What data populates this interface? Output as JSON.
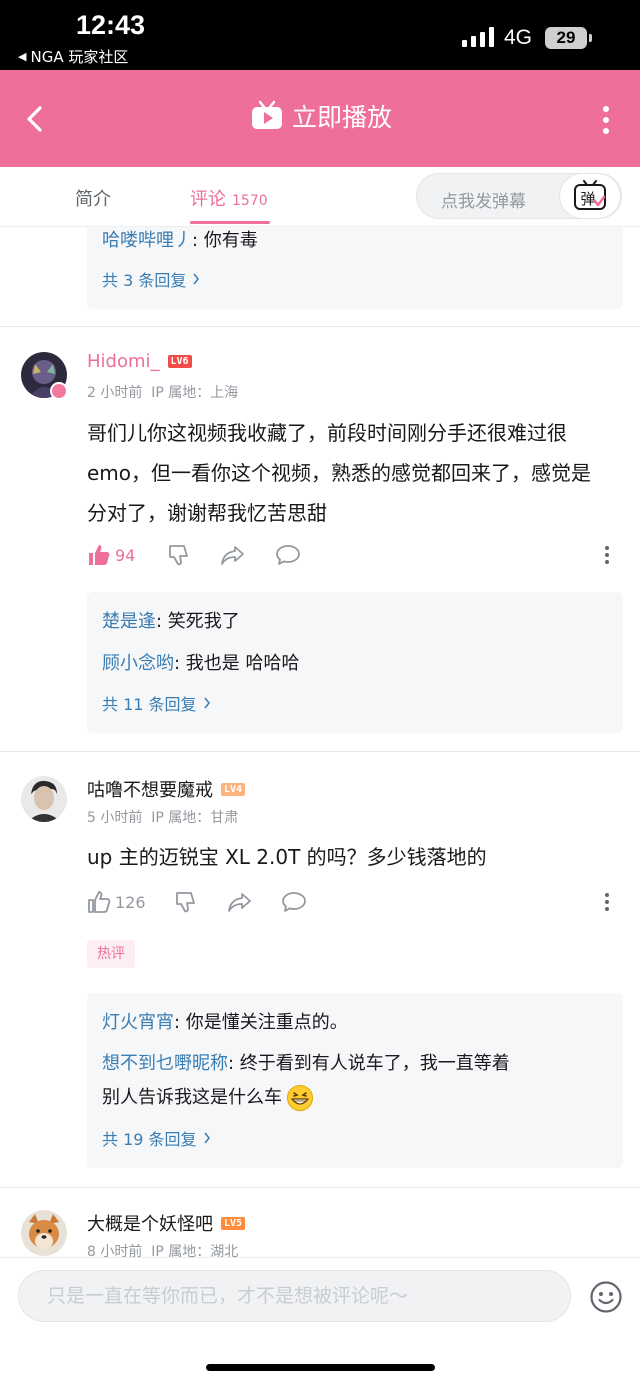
{
  "status_bar": {
    "time": "12:43",
    "back_app": "NGA 玩家社区",
    "network": "4G",
    "battery": "29"
  },
  "header": {
    "title": "立即播放"
  },
  "tabs": {
    "intro": "简介",
    "comment": "评论",
    "comment_count": "1570",
    "danmaku_placeholder": "点我发弹幕",
    "danmaku_button": "弹"
  },
  "top_reply": {
    "line": {
      "user": "哈喽哔哩丿",
      "sep": ": ",
      "text": "你有毒"
    },
    "more": "共 3 条回复"
  },
  "comments": [
    {
      "username": "Hidomi_",
      "level": "LV6",
      "time": "2 小时前",
      "ip": "IP 属地：上海",
      "text": "哥们儿你这视频我收藏了，前段时间刚分手还很难过很 emo，但一看你这个视频，熟悉的感觉都回来了，感觉是分对了，谢谢帮我忆苦思甜",
      "likes": "94",
      "replies": [
        {
          "user": "楚是逢",
          "sep": ": ",
          "text": "笑死我了"
        },
        {
          "user": "顾小念哟",
          "sep": ": ",
          "text": "我也是  哈哈哈"
        }
      ],
      "more": "共 11 条回复"
    },
    {
      "username": "咕噜不想要魔戒",
      "level": "LV4",
      "time": "5 小时前",
      "ip": "IP 属地：甘肃",
      "text": "up 主的迈锐宝 XL  2.0T 的吗？多少钱落地的",
      "likes": "126",
      "tag": "热评",
      "replies": [
        {
          "user": "灯火宵宵",
          "sep": ": ",
          "text": "你是懂关注重点的。"
        },
        {
          "user": "想不到乜嘢昵称",
          "sep": ": ",
          "text": "终于看到有人说车了，我一直等着",
          "text2": "别人告诉我这是什么车"
        }
      ],
      "more": "共 19 条回复"
    },
    {
      "username": "大概是个妖怪吧",
      "level": "LV5",
      "time": "8 小时前",
      "ip": "IP 属地：湖北"
    }
  ],
  "bottom": {
    "placeholder": "只是一直在等你而已，才不是想被评论呢～"
  },
  "colors": {
    "brand_pink": "#ee6f9b",
    "link_blue": "#3a7db3",
    "lv6": "#f04c49",
    "lv4": "#ffb37c",
    "lv5": "#ff8c3a"
  }
}
